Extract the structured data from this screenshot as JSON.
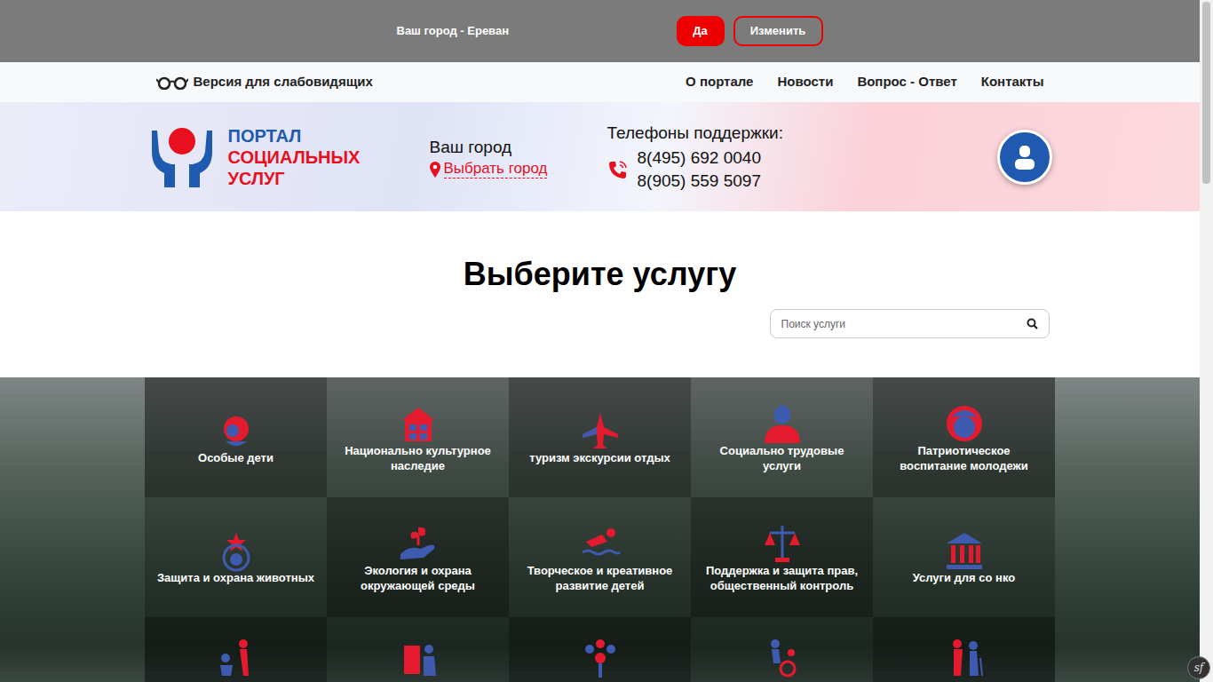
{
  "city_bar": {
    "text": "Ваш город - Ереван",
    "confirm": "Да",
    "change": "Изменить"
  },
  "nav": {
    "accessibility": "Версия для слабовидящих",
    "links": [
      "О портале",
      "Новости",
      "Вопрос - Ответ",
      "Контакты"
    ]
  },
  "header": {
    "logo": [
      "ПОРТАЛ",
      "СОЦИАЛЬНЫХ",
      "УСЛУГ"
    ],
    "city_label": "Ваш город",
    "city_link": "Выбрать город",
    "phones_label": "Телефоны поддержки:",
    "phones": [
      "8(495) 692 0040",
      "8(905) 559 5097"
    ]
  },
  "services": {
    "title": "Выберите услугу",
    "search_placeholder": "Поиск услуги",
    "tiles": [
      {
        "label": "Особые дети"
      },
      {
        "label": "Национально культурное наследие"
      },
      {
        "label": "туризм экскурсии отдых"
      },
      {
        "label": "Социально трудовые услуги"
      },
      {
        "label": "Патриотическое воспитание молодежи"
      },
      {
        "label": "Защита и охрана животных"
      },
      {
        "label": "Экология и охрана окружающей среды"
      },
      {
        "label": "Творческое и креативное развитие детей"
      },
      {
        "label": "Поддержка и защита прав, общественный контроль"
      },
      {
        "label": "Услуги для со нко"
      }
    ]
  },
  "debug_badge": "sf"
}
